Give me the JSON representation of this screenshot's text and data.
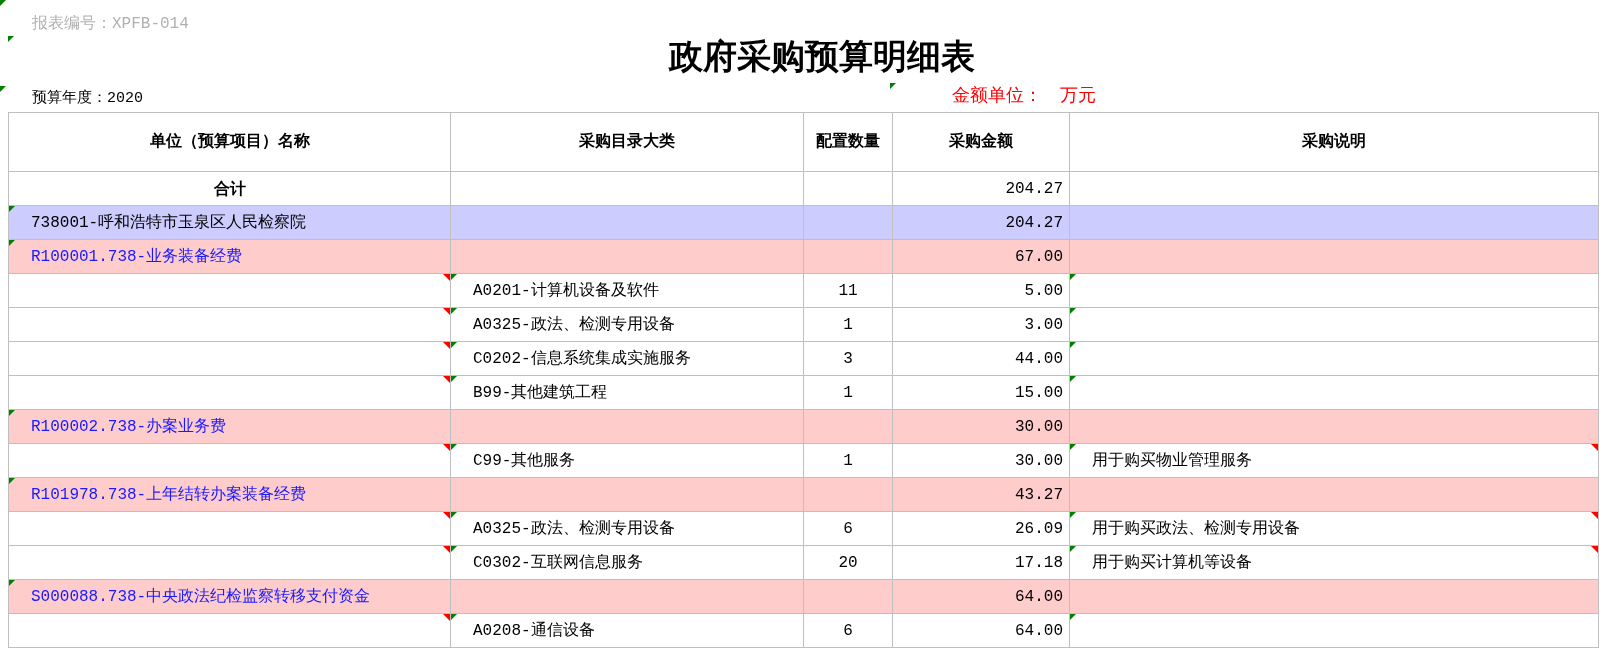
{
  "report_no": {
    "text": "报表编号：XPFB-014",
    "flag": true
  },
  "title": "政府采购预算明细表",
  "title_row_flag": true,
  "year": {
    "text": "预算年度：2020",
    "flag": true
  },
  "unit_note": "金额单位：　万元",
  "title_flag": true,
  "columns": [
    "单位（预算项目）名称",
    "采购目录大类",
    "配置数量",
    "采购金额",
    "采购说明"
  ],
  "rows": [
    {
      "kind": "total",
      "name": "合计",
      "category": "",
      "quantity": "",
      "amount": "204.27",
      "description": ""
    },
    {
      "kind": "unit",
      "name": "738001-呼和浩特市玉泉区人民检察院",
      "category": "",
      "quantity": "",
      "amount": "204.27",
      "description": "",
      "name_flag": true
    },
    {
      "kind": "project",
      "name": "R100001.738-业务装备经费",
      "category": "",
      "quantity": "",
      "amount": "67.00",
      "description": "",
      "name_flag": true
    },
    {
      "kind": "item",
      "name": "",
      "category": "A0201-计算机设备及软件",
      "quantity": "11",
      "amount": "5.00",
      "description": "",
      "name_comment": true,
      "category_flag": true,
      "description_flag": true
    },
    {
      "kind": "item",
      "name": "",
      "category": "A0325-政法、检测专用设备",
      "quantity": "1",
      "amount": "3.00",
      "description": "",
      "name_comment": true,
      "category_flag": true,
      "description_flag": true
    },
    {
      "kind": "item",
      "name": "",
      "category": "C0202-信息系统集成实施服务",
      "quantity": "3",
      "amount": "44.00",
      "description": "",
      "name_comment": true,
      "category_flag": true,
      "description_flag": true
    },
    {
      "kind": "item",
      "name": "",
      "category": "B99-其他建筑工程",
      "quantity": "1",
      "amount": "15.00",
      "description": "",
      "name_comment": true,
      "category_flag": true,
      "description_flag": true
    },
    {
      "kind": "project",
      "name": "R100002.738-办案业务费",
      "category": "",
      "quantity": "",
      "amount": "30.00",
      "description": "",
      "name_flag": true
    },
    {
      "kind": "item",
      "name": "",
      "category": "C99-其他服务",
      "quantity": "1",
      "amount": "30.00",
      "description": "用于购买物业管理服务",
      "name_comment": true,
      "category_flag": true,
      "description_flag": true,
      "description_comment": true
    },
    {
      "kind": "project",
      "name": "R101978.738-上年结转办案装备经费",
      "category": "",
      "quantity": "",
      "amount": "43.27",
      "description": "",
      "name_flag": true
    },
    {
      "kind": "item",
      "name": "",
      "category": "A0325-政法、检测专用设备",
      "quantity": "6",
      "amount": "26.09",
      "description": "用于购买政法、检测专用设备",
      "name_comment": true,
      "category_flag": true,
      "description_flag": true,
      "description_comment": true
    },
    {
      "kind": "item",
      "name": "",
      "category": "C0302-互联网信息服务",
      "quantity": "20",
      "amount": "17.18",
      "description": "用于购买计算机等设备",
      "name_comment": true,
      "category_flag": true,
      "description_flag": true,
      "description_comment": true
    },
    {
      "kind": "project",
      "name": "S000088.738-中央政法纪检监察转移支付资金",
      "category": "",
      "quantity": "",
      "amount": "64.00",
      "description": "",
      "name_flag": true
    },
    {
      "kind": "item",
      "name": "",
      "category": "A0208-通信设备",
      "quantity": "6",
      "amount": "64.00",
      "description": "",
      "name_comment": true,
      "category_flag": true,
      "description_flag": true
    }
  ]
}
